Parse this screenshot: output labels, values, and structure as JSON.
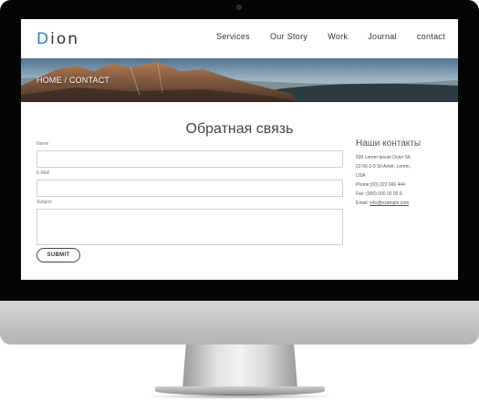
{
  "site": {
    "logo": {
      "first_letter": "D",
      "rest": "ion"
    },
    "nav": [
      "Services",
      "Our Story",
      "Work",
      "Journal",
      "contact"
    ],
    "breadcrumb": "HOME / CONTACT"
  },
  "contact_form": {
    "title": "Обратная связь",
    "name_label": "Name",
    "email_label": "E-Mail",
    "subject_label": "Subject",
    "submit_label": "SUBMIT"
  },
  "contacts": {
    "title": "Наши контакты",
    "address_line1": "500 Lorem Ipsum Dolor Sit,",
    "address_line2": "22-56-2-9 Sit Amet, Lorem,",
    "address_line3": "USA",
    "phone": "Phone:(00) 222 666 444",
    "fax": "Fax: (000) 000 00 00 0",
    "email_prefix": "Email: ",
    "email": "info@example.com"
  },
  "colors": {
    "logo_accent": "#2f7fc1",
    "bezel": "#050505",
    "text_dark": "#333333"
  },
  "icons": [
    "camera-icon"
  ]
}
